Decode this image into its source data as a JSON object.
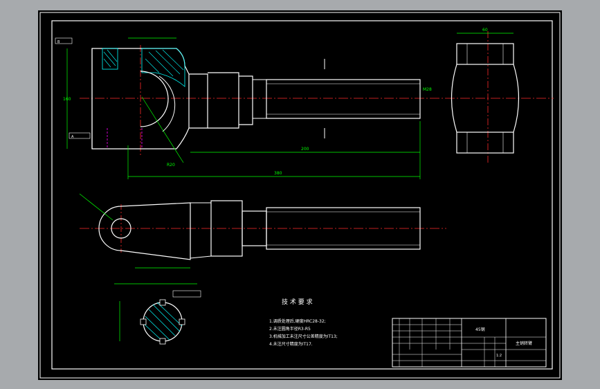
{
  "tech_requirements": {
    "title": "技 术 要 求",
    "items": [
      "1.调质处理后,硬度HRC28-32;",
      "2.未注圆角半径R3-R5",
      "3.机械加工未注尺寸公差精度为IT13;",
      "4.未注尺寸精度为IT17."
    ]
  },
  "title_block": {
    "material": "45钢",
    "part_name": "主销转臂",
    "scale": "1:2"
  },
  "dimensions": {
    "thread": "M28",
    "length_total": "380",
    "length_body": "160",
    "length_shaft": "200",
    "dia_head": "60",
    "ref_b": "B",
    "ref_a": "A",
    "radius": "R20"
  },
  "colors": {
    "sheet": "#000000",
    "border": "#ffffff",
    "part_outline": "#ffffff",
    "centerline": "#ff2a2a",
    "dimension": "#00ff00",
    "hatch": "#00ffff",
    "hidden": "#ff00ff",
    "text": "#ffffff"
  }
}
